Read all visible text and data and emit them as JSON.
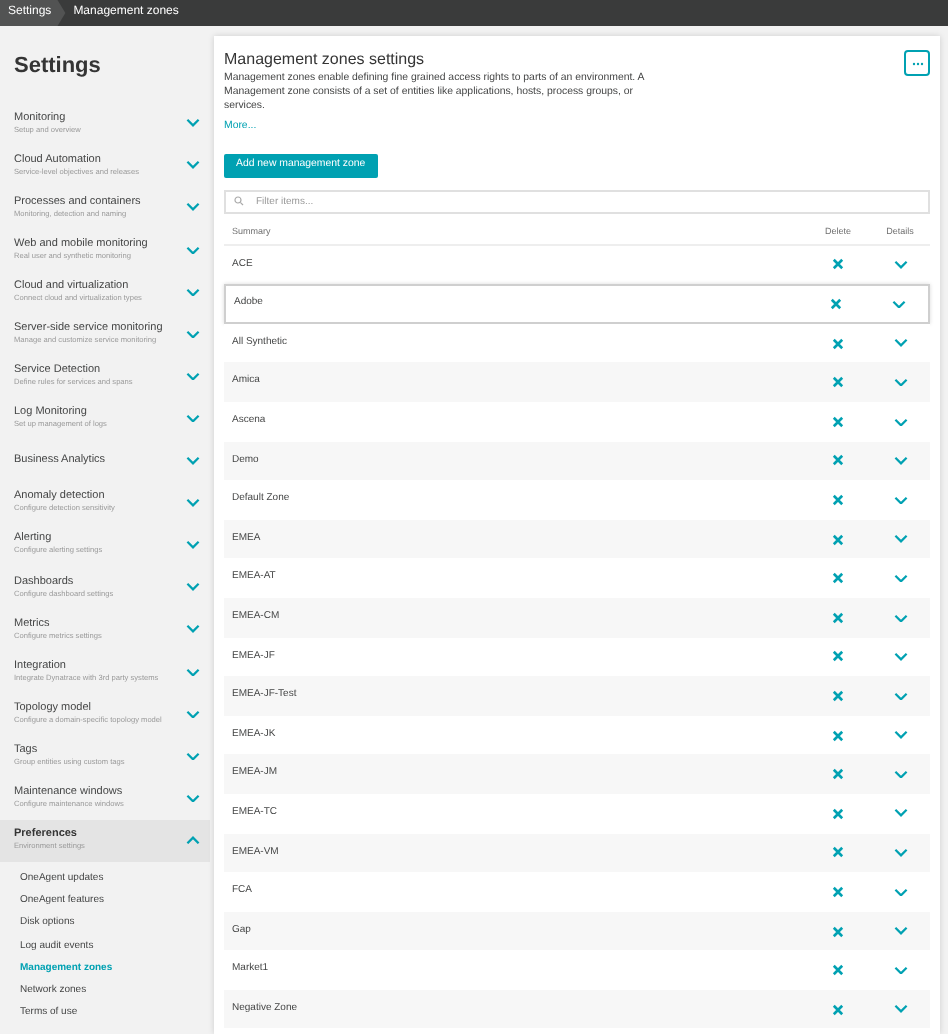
{
  "breadcrumb": [
    {
      "label": "Settings"
    },
    {
      "label": "Management zones"
    }
  ],
  "sidebar": {
    "title": "Settings",
    "items": [
      {
        "title": "Monitoring",
        "subtitle": "Setup and overview",
        "expanded": false
      },
      {
        "title": "Cloud Automation",
        "subtitle": "Service-level objectives and releases",
        "expanded": false
      },
      {
        "title": "Processes and containers",
        "subtitle": "Monitoring, detection and naming",
        "expanded": false
      },
      {
        "title": "Web and mobile monitoring",
        "subtitle": "Real user and synthetic monitoring",
        "expanded": false
      },
      {
        "title": "Cloud and virtualization",
        "subtitle": "Connect cloud and virtualization types",
        "expanded": false
      },
      {
        "title": "Server-side service monitoring",
        "subtitle": "Manage and customize service monitoring",
        "expanded": false
      },
      {
        "title": "Service Detection",
        "subtitle": "Define rules for services and spans",
        "expanded": false
      },
      {
        "title": "Log Monitoring",
        "subtitle": "Set up management of logs",
        "expanded": false
      },
      {
        "title": "Business Analytics",
        "expanded": false
      },
      {
        "title": "Anomaly detection",
        "subtitle": "Configure detection sensitivity",
        "expanded": false
      },
      {
        "title": "Alerting",
        "subtitle": "Configure alerting settings",
        "expanded": false
      },
      {
        "title": "Dashboards",
        "subtitle": "Configure dashboard settings",
        "expanded": false
      },
      {
        "title": "Metrics",
        "subtitle": "Configure metrics settings",
        "expanded": false
      },
      {
        "title": "Integration",
        "subtitle": "Integrate Dynatrace with 3rd party systems",
        "expanded": false
      },
      {
        "title": "Topology model",
        "subtitle": "Configure a domain-specific topology model",
        "expanded": false
      },
      {
        "title": "Tags",
        "subtitle": "Group entities using custom tags",
        "expanded": false
      },
      {
        "title": "Maintenance windows",
        "subtitle": "Configure maintenance windows",
        "expanded": false
      },
      {
        "title": "Preferences",
        "subtitle": "Environment settings",
        "expanded": true,
        "children": [
          {
            "label": "OneAgent updates",
            "selected": false
          },
          {
            "label": "OneAgent features",
            "selected": false
          },
          {
            "label": "Disk options",
            "selected": false
          },
          {
            "label": "Log audit events",
            "selected": false
          },
          {
            "label": "Management zones",
            "selected": true
          },
          {
            "label": "Network zones",
            "selected": false
          },
          {
            "label": "Terms of use",
            "selected": false
          }
        ]
      }
    ]
  },
  "main": {
    "title": "Management zones settings",
    "description": "Management zones enable defining fine grained access rights to parts of an environment. A Management zone consists of a set of entities like applications, hosts, process groups, or services.",
    "more_link": "More...",
    "add_button": "Add new management zone",
    "filter": {
      "placeholder": "Filter items..."
    },
    "table": {
      "columns": [
        "Summary",
        "Delete",
        "Details"
      ],
      "rows": [
        {
          "summary": "ACE",
          "selected": false
        },
        {
          "summary": "Adobe",
          "selected": true
        },
        {
          "summary": "All Synthetic",
          "selected": false
        },
        {
          "summary": "Amica",
          "selected": false
        },
        {
          "summary": "Ascena",
          "selected": false
        },
        {
          "summary": "Demo",
          "selected": false
        },
        {
          "summary": "Default Zone",
          "selected": false
        },
        {
          "summary": "EMEA",
          "selected": false
        },
        {
          "summary": "EMEA-AT",
          "selected": false
        },
        {
          "summary": "EMEA-CM",
          "selected": false
        },
        {
          "summary": "EMEA-JF",
          "selected": false
        },
        {
          "summary": "EMEA-JF-Test",
          "selected": false
        },
        {
          "summary": "EMEA-JK",
          "selected": false
        },
        {
          "summary": "EMEA-JM",
          "selected": false
        },
        {
          "summary": "EMEA-TC",
          "selected": false
        },
        {
          "summary": "EMEA-VM",
          "selected": false
        },
        {
          "summary": "FCA",
          "selected": false
        },
        {
          "summary": "Gap",
          "selected": false
        },
        {
          "summary": "Market1",
          "selected": false
        },
        {
          "summary": "Negative Zone",
          "selected": false
        }
      ]
    }
  }
}
